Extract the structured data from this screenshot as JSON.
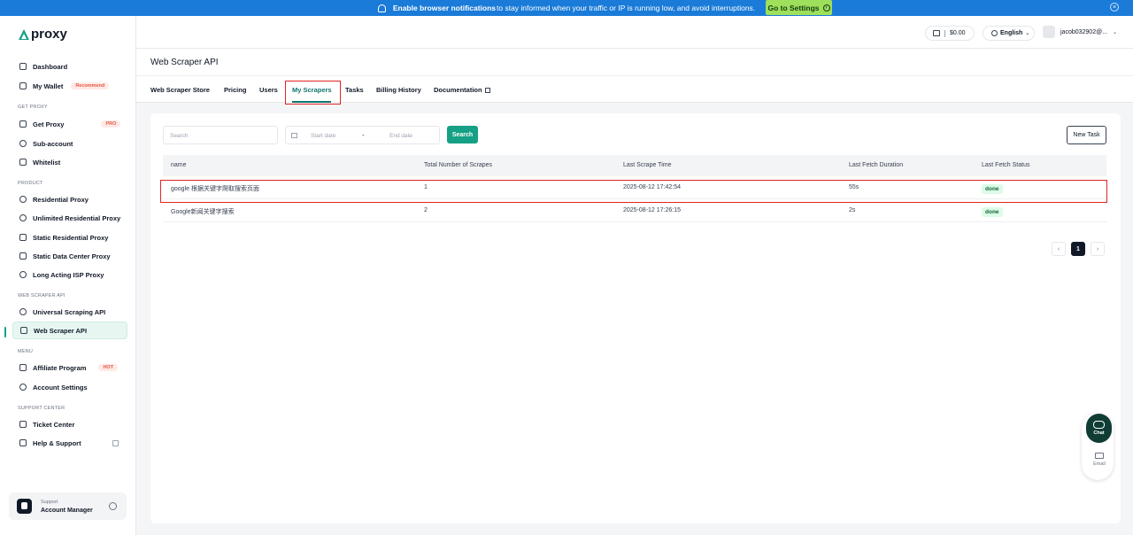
{
  "banner": {
    "bold_text": "Enable browser notifications",
    "text": "to stay informed when your traffic or IP is running low, and avoid interruptions.",
    "button_label": "Go to Settings"
  },
  "brand": {
    "name": "proxy",
    "color": "#16a085"
  },
  "sidebar": {
    "items": [
      {
        "label": "Dashboard",
        "icon": "dashboard-icon"
      },
      {
        "label": "My Wallet",
        "icon": "wallet-icon",
        "tag": "Recommend"
      },
      {
        "section": "GET PROXY"
      },
      {
        "label": "Get Proxy",
        "icon": "proxy-icon",
        "tag": "PRO"
      },
      {
        "label": "Sub-account",
        "icon": "user-icon"
      },
      {
        "label": "Whitelist",
        "icon": "list-icon"
      },
      {
        "section": "PRODUCT"
      },
      {
        "label": "Residential Proxy",
        "icon": "globe-icon"
      },
      {
        "label": "Unlimited Residential Proxy",
        "icon": "globe-icon"
      },
      {
        "label": "Static Residential Proxy",
        "icon": "grid-icon"
      },
      {
        "label": "Static Data Center Proxy",
        "icon": "server-icon"
      },
      {
        "label": "Long Acting ISP Proxy",
        "icon": "clock-icon"
      },
      {
        "section": "WEB SCRAPER API"
      },
      {
        "label": "Universal Scraping API",
        "icon": "link-icon"
      },
      {
        "label": "Web Scraper API",
        "icon": "scraper-icon",
        "active": true
      },
      {
        "section": "MENU"
      },
      {
        "label": "Affiliate Program",
        "icon": "megaphone-icon",
        "tag": "HOT"
      },
      {
        "label": "Account Settings",
        "icon": "gear-icon"
      },
      {
        "section": "SUPPORT CENTER"
      },
      {
        "label": "Ticket Center",
        "icon": "ticket-icon"
      },
      {
        "label": "Help & Support",
        "icon": "help-icon"
      }
    ],
    "support": {
      "line1": "Support",
      "line2": "Account Manager"
    }
  },
  "header": {
    "balance": "$0.00",
    "language": "English",
    "user": "jacob032902@..."
  },
  "page": {
    "title": "Web Scraper API",
    "tabs": [
      "Web Scraper Store",
      "Pricing",
      "Users",
      "My Scrapers",
      "Tasks",
      "Billing History",
      "Documentation"
    ],
    "active_tab": "My Scrapers"
  },
  "filters": {
    "search_placeholder": "Search",
    "start_date_placeholder": "Start date",
    "date_separator": "-",
    "end_date_placeholder": "End date",
    "search_button": "Search",
    "new_task_button": "New Task"
  },
  "table": {
    "columns": [
      "name",
      "Total Number of Scrapes",
      "Last Scrape Time",
      "Last Fetch Duration",
      "Last Fetch Status"
    ],
    "rows": [
      {
        "name": "google 根据关键字爬取搜索页面",
        "total": "1",
        "time": "2025-08-12 17:42:54",
        "duration": "55s",
        "status": "done"
      },
      {
        "name": "Google新闻关键字搜索",
        "total": "2",
        "time": "2025-08-12 17:26:15",
        "duration": "2s",
        "status": "done"
      }
    ]
  },
  "pagination": {
    "prev": "‹",
    "current": "1",
    "next": "›"
  },
  "floating": {
    "chat": "Chat",
    "email": "Email"
  }
}
